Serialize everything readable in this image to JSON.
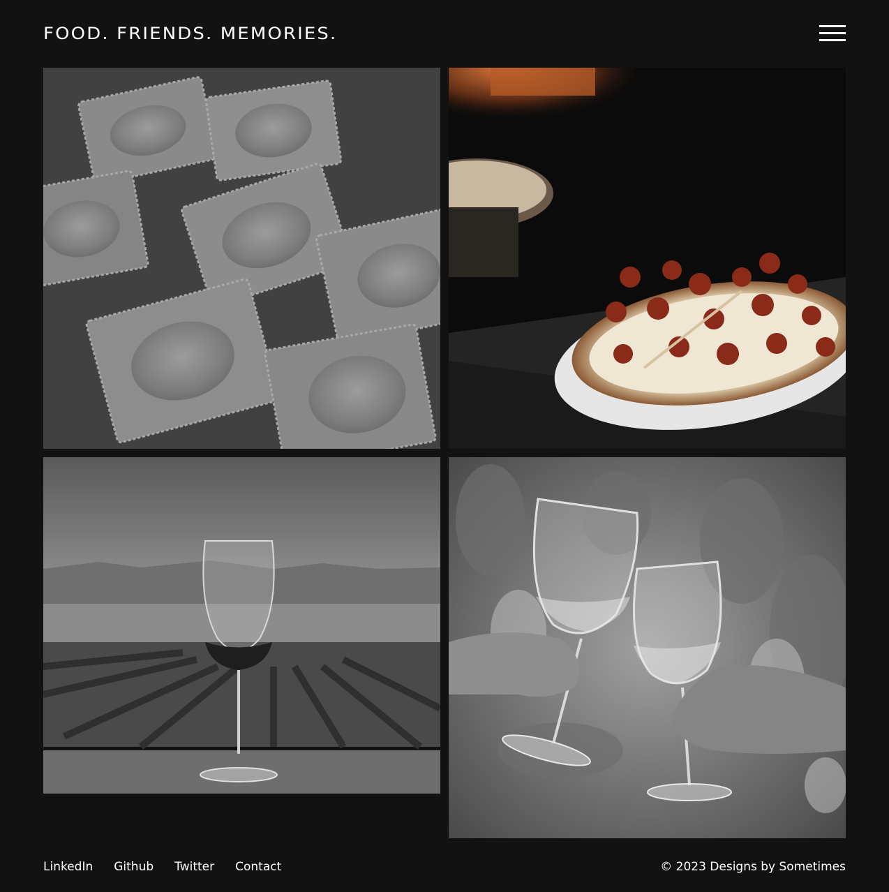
{
  "header": {
    "title": "FOOD. FRIENDS. MEMORIES.",
    "menu_icon": "hamburger-menu-icon"
  },
  "gallery": {
    "tiles": [
      {
        "subject": "ravioli",
        "treatment": "grayscale"
      },
      {
        "subject": "pepperoni-pizza",
        "treatment": "color"
      },
      {
        "subject": "wine-glass-vineyard",
        "treatment": "grayscale"
      },
      {
        "subject": "wine-toast",
        "treatment": "grayscale"
      }
    ]
  },
  "footer": {
    "links": [
      "LinkedIn",
      "Github",
      "Twitter",
      "Contact"
    ],
    "copyright": "© 2023 Designs by Sometimes"
  },
  "colors": {
    "background": "#121212",
    "text": "#ffffff"
  }
}
